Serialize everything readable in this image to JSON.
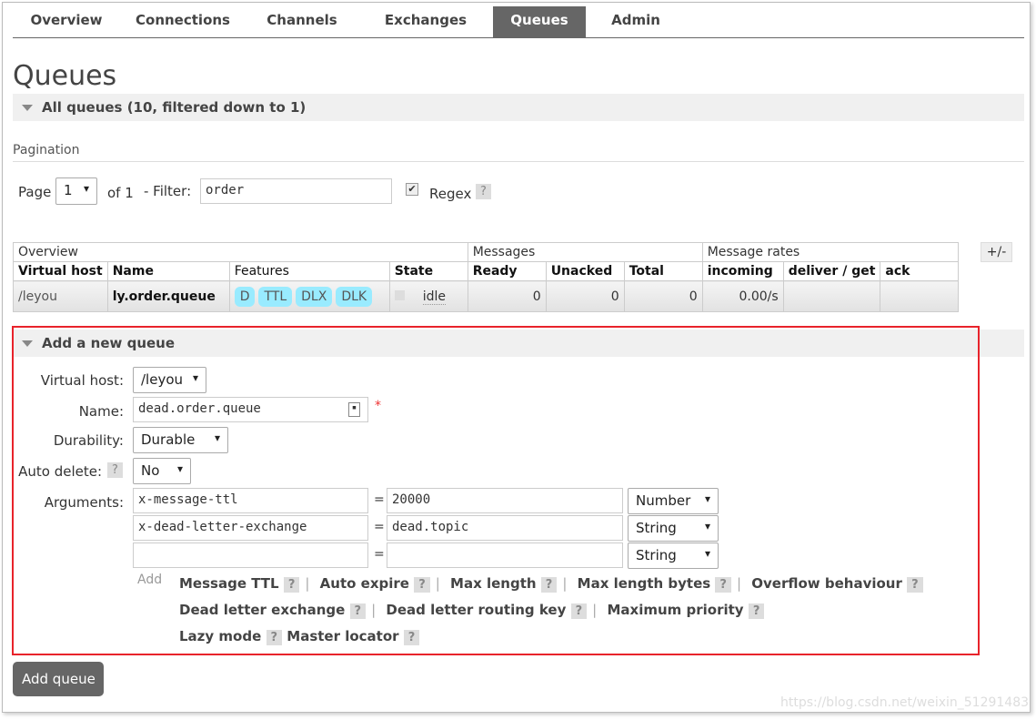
{
  "nav": {
    "tabs": [
      "Overview",
      "Connections",
      "Channels",
      "Exchanges",
      "Queues",
      "Admin"
    ],
    "active": "Queues"
  },
  "page_title": "Queues",
  "all_queues": {
    "title": "All queues (10, filtered down to 1)"
  },
  "pagination": {
    "label": "Pagination",
    "page_label": "Page",
    "page_value": "1",
    "of": "of 1",
    "filter_label": "- Filter:",
    "filter_value": "order",
    "regex_label": "Regex",
    "regex_checked": true,
    "help": "?"
  },
  "table": {
    "groups": [
      "Overview",
      "Messages",
      "Message rates"
    ],
    "plus_minus": "+/-",
    "headers": [
      "Virtual host",
      "Name",
      "Features",
      "State",
      "Ready",
      "Unacked",
      "Total",
      "incoming",
      "deliver / get",
      "ack"
    ],
    "rows": [
      {
        "vhost": "/leyou",
        "name": "ly.order.queue",
        "features": [
          "D",
          "TTL",
          "DLX",
          "DLK"
        ],
        "state": "idle",
        "ready": "0",
        "unacked": "0",
        "total": "0",
        "incoming": "0.00/s",
        "deliver": "",
        "ack": ""
      }
    ]
  },
  "add_queue": {
    "title": "Add a new queue",
    "vhost_label": "Virtual host:",
    "vhost": "/leyou",
    "name_label": "Name:",
    "name": "dead.order.queue",
    "required": "*",
    "durability_label": "Durability:",
    "durability": "Durable",
    "auto_delete_label": "Auto delete:",
    "auto_delete": "No",
    "arguments_label": "Arguments:",
    "arguments": [
      {
        "key": "x-message-ttl",
        "value": "20000",
        "type": "Number"
      },
      {
        "key": "x-dead-letter-exchange",
        "value": "dead.topic",
        "type": "String"
      },
      {
        "key": "",
        "value": "",
        "type": "String"
      }
    ],
    "eq": "=",
    "add_label": "Add",
    "options": [
      [
        "Message TTL",
        "Auto expire",
        "Max length",
        "Max length bytes",
        "Overflow behaviour"
      ],
      [
        "Dead letter exchange",
        "Dead letter routing key",
        "Maximum priority"
      ],
      [
        "Lazy mode",
        "Master locator"
      ]
    ],
    "submit": "Add queue"
  },
  "watermark": "https://blog.csdn.net/weixin_51291483",
  "colors": {
    "highlight_border": "#e8232b",
    "feature_badge": "#99ebff",
    "active_tab": "#666666"
  }
}
